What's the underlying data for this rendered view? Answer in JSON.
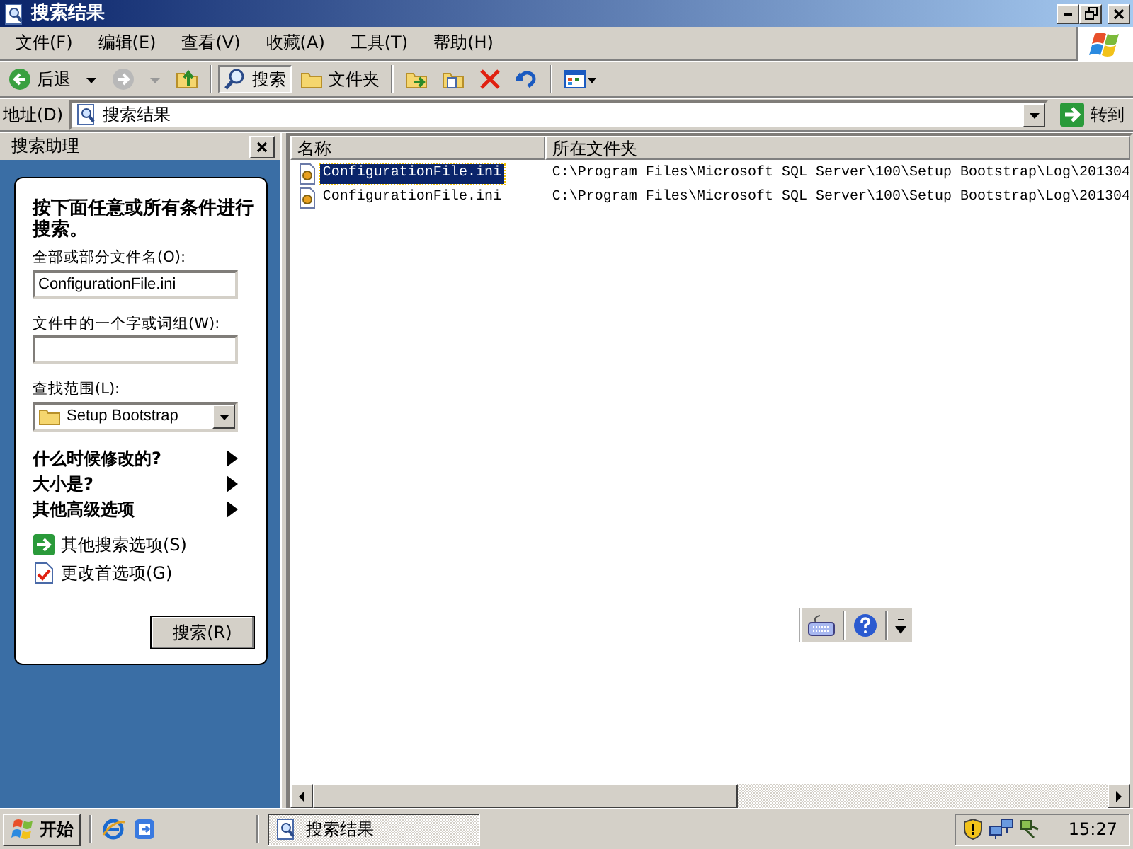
{
  "window": {
    "title": "搜索结果"
  },
  "menu": [
    {
      "label": "文件(F)"
    },
    {
      "label": "编辑(E)"
    },
    {
      "label": "查看(V)"
    },
    {
      "label": "收藏(A)"
    },
    {
      "label": "工具(T)"
    },
    {
      "label": "帮助(H)"
    }
  ],
  "toolbar": {
    "back": "后退",
    "search": {
      "label": "搜索",
      "selected": true
    },
    "folders": "文件夹"
  },
  "address": {
    "label": "地址(D)",
    "value": "搜索结果",
    "go": "转到"
  },
  "search_pane": {
    "title": "搜索助理",
    "heading": "按下面任意或所有条件进行搜索。",
    "filename_label": "全部或部分文件名(O):",
    "filename_value": "ConfigurationFile.ini",
    "phrase_label": "文件中的一个字或词组(W):",
    "look_in_label": "查找范围(L):",
    "look_in_value": "Setup Bootstrap",
    "options": [
      "什么时候修改的?",
      "大小是?",
      "其他高级选项"
    ],
    "links": [
      "其他搜索选项(S)",
      "更改首选项(G)"
    ],
    "search_button": "搜索(R)"
  },
  "results": {
    "columns": [
      "名称",
      "所在文件夹"
    ],
    "rows": [
      {
        "name": "ConfigurationFile.ini",
        "folder": "C:\\Program Files\\Microsoft SQL Server\\100\\Setup Bootstrap\\Log\\201304",
        "selected": true
      },
      {
        "name": "ConfigurationFile.ini",
        "folder": "C:\\Program Files\\Microsoft SQL Server\\100\\Setup Bootstrap\\Log\\201304",
        "selected": false
      }
    ]
  },
  "taskbar": {
    "start": "开始",
    "task": "搜索结果",
    "clock": "15:27"
  }
}
